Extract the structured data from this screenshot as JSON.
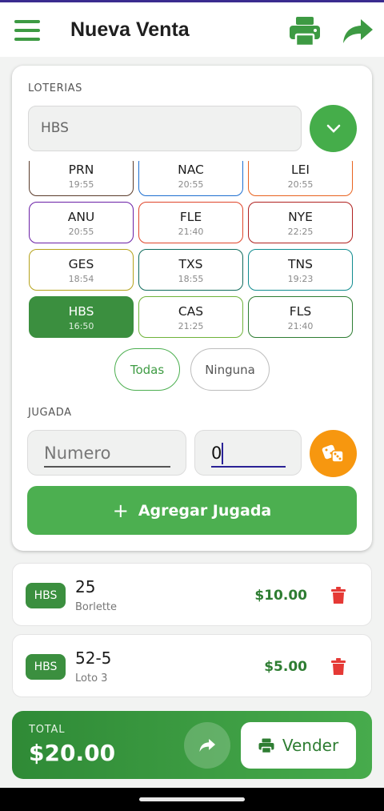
{
  "header": {
    "title": "Nueva Venta"
  },
  "loterias": {
    "label": "LOTERIAS",
    "selected": "HBS",
    "chips": [
      {
        "code": "PRN",
        "time": "19:55",
        "color": "#5a3b2a",
        "selected": false
      },
      {
        "code": "NAC",
        "time": "20:55",
        "color": "#1e6fd0",
        "selected": false
      },
      {
        "code": "LEI",
        "time": "20:55",
        "color": "#e8631f",
        "selected": false
      },
      {
        "code": "ANU",
        "time": "20:55",
        "color": "#6a1fa6",
        "selected": false
      },
      {
        "code": "FLE",
        "time": "21:40",
        "color": "#e0452a",
        "selected": false
      },
      {
        "code": "NYE",
        "time": "22:25",
        "color": "#b0211f",
        "selected": false
      },
      {
        "code": "GES",
        "time": "18:54",
        "color": "#b5a21a",
        "selected": false
      },
      {
        "code": "TXS",
        "time": "18:55",
        "color": "#0f6b5c",
        "selected": false
      },
      {
        "code": "TNS",
        "time": "19:23",
        "color": "#108c8f",
        "selected": false
      },
      {
        "code": "HBS",
        "time": "16:50",
        "color": "#3b8f3f",
        "selected": true
      },
      {
        "code": "CAS",
        "time": "21:25",
        "color": "#6fb33a",
        "selected": false
      },
      {
        "code": "FLS",
        "time": "21:40",
        "color": "#2e7d32",
        "selected": false
      }
    ],
    "todas": "Todas",
    "ninguna": "Ninguna"
  },
  "jugada": {
    "label": "JUGADA",
    "numero_placeholder": "Numero",
    "amount_value": "0",
    "add_label": "Agregar Jugada"
  },
  "items": [
    {
      "badge": "HBS",
      "number": "25",
      "game": "Borlette",
      "amount": "$10.00"
    },
    {
      "badge": "HBS",
      "number": "52-5",
      "game": "Loto 3",
      "amount": "$5.00"
    }
  ],
  "footer": {
    "total_label": "TOTAL",
    "total_value": "$20.00",
    "vender_label": "Vender"
  },
  "colors": {
    "primary": "#4caf50",
    "dark_green": "#2e7d32",
    "orange": "#f7970f",
    "danger": "#e53935"
  }
}
